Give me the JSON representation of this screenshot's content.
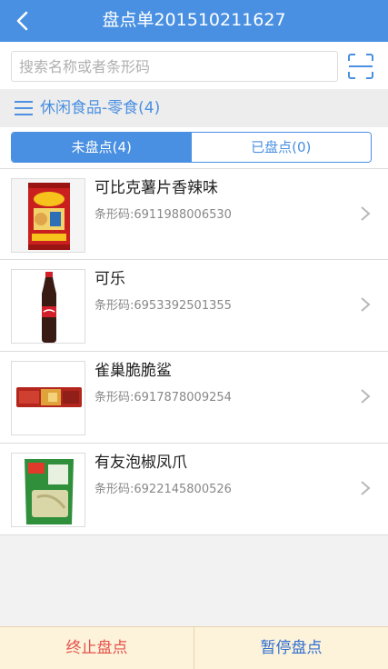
{
  "header": {
    "title": "盘点单201510211627",
    "back_icon": "chevron-left-icon"
  },
  "search": {
    "placeholder": "搜索名称或者条形码",
    "value": "",
    "scan_icon": "scan-icon"
  },
  "category": {
    "icon": "menu-icon",
    "label": "休闲食品-零食(4)"
  },
  "tabs": [
    {
      "label": "未盘点(4)",
      "active": true
    },
    {
      "label": "已盘点(0)",
      "active": false
    }
  ],
  "items": [
    {
      "name": "可比克薯片香辣味",
      "barcode": "条形码:6911988006530"
    },
    {
      "name": "可乐",
      "barcode": "条形码:6953392501355"
    },
    {
      "name": "雀巢脆脆鲨",
      "barcode": "条形码:6917878009254"
    },
    {
      "name": "有友泡椒凤爪",
      "barcode": "条形码:6922145800526"
    }
  ],
  "actions": {
    "stop_label": "终止盘点",
    "pause_label": "暂停盘点"
  },
  "colors": {
    "primary": "#4a90e2",
    "stop": "#e5534b",
    "pause": "#2f6fd0",
    "bottom_bg": "#fdf2da"
  }
}
